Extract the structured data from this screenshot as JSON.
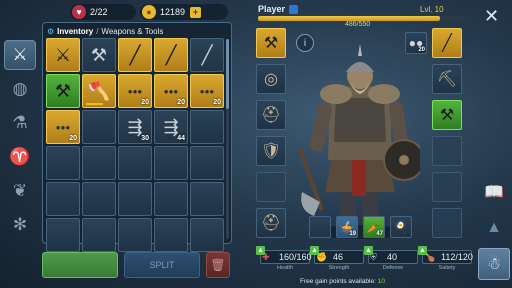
{
  "top_bar": {
    "energy": {
      "icon": "heart-icon",
      "value": "2/22"
    },
    "gold": {
      "icon": "coin-icon",
      "value": "12189",
      "add": "+"
    }
  },
  "side_tabs": [
    {
      "name": "weapons-tab",
      "icon": "crossed-axes-icon",
      "glyph": "⚔",
      "active": true
    },
    {
      "name": "globe-tab",
      "icon": "globe-icon",
      "glyph": "◍",
      "active": false
    },
    {
      "name": "potions-tab",
      "icon": "flask-icon",
      "glyph": "⚗",
      "active": false
    },
    {
      "name": "horn-tab",
      "icon": "horn-icon",
      "glyph": "♈",
      "active": false
    },
    {
      "name": "wings-tab",
      "icon": "wings-icon",
      "glyph": "❦",
      "active": false
    },
    {
      "name": "snowflake-tab",
      "icon": "snowflake-icon",
      "glyph": "✻",
      "active": false
    }
  ],
  "inventory": {
    "breadcrumb_root": "Inventory",
    "breadcrumb_sep": "/",
    "breadcrumb_current": "Weapons & Tools",
    "slots": [
      {
        "style": "gold",
        "glyph": "⚔",
        "count": ""
      },
      {
        "style": "dark",
        "glyph": "⚒",
        "count": ""
      },
      {
        "style": "gold",
        "glyph": "╱",
        "count": ""
      },
      {
        "style": "gold",
        "glyph": "╱",
        "count": ""
      },
      {
        "style": "dark",
        "glyph": "╱",
        "count": ""
      },
      {
        "style": "green",
        "glyph": "⚒",
        "count": ""
      },
      {
        "style": "gold",
        "glyph": "🪓",
        "count": "",
        "bar": 0.6
      },
      {
        "style": "gold",
        "glyph": "●●●",
        "count": "20"
      },
      {
        "style": "gold",
        "glyph": "●●●",
        "count": "20"
      },
      {
        "style": "gold",
        "glyph": "●●●",
        "count": "20"
      },
      {
        "style": "gold",
        "glyph": "●●●",
        "count": "20"
      },
      {
        "style": "empty",
        "glyph": "",
        "count": ""
      },
      {
        "style": "dark",
        "glyph": "⇶",
        "count": "30"
      },
      {
        "style": "dark",
        "glyph": "⇶",
        "count": "44"
      },
      {
        "style": "empty",
        "glyph": "",
        "count": ""
      },
      {
        "style": "empty",
        "glyph": "",
        "count": ""
      },
      {
        "style": "empty",
        "glyph": "",
        "count": ""
      },
      {
        "style": "empty",
        "glyph": "",
        "count": ""
      }
    ]
  },
  "buttons": {
    "equip": "",
    "split": "SPLIT",
    "delete": "🗑"
  },
  "player": {
    "name": "Player",
    "level": "Lvl. 10",
    "xp": "486/550",
    "xp_fraction": 0.8836
  },
  "equipment_left": [
    {
      "style": "gold",
      "glyph": "⚒",
      "name": "main-weapon-slot"
    },
    {
      "style": "dark",
      "glyph": "◎",
      "name": "shield-slot"
    },
    {
      "style": "dark",
      "glyph": "⛑",
      "name": "helmet-slot"
    },
    {
      "style": "dark",
      "glyph": "🛡",
      "name": "armor-slot"
    },
    {
      "style": "empty",
      "glyph": "",
      "name": "pants-slot"
    },
    {
      "style": "dark",
      "glyph": "⛑",
      "name": "boots-slot"
    }
  ],
  "equipment_right": [
    {
      "style": "gold",
      "glyph": "╱",
      "name": "spear-slot"
    },
    {
      "style": "dark",
      "glyph": "⛏",
      "name": "pickaxe-slot"
    },
    {
      "style": "green",
      "glyph": "⚒",
      "name": "axe-slot"
    },
    {
      "style": "empty",
      "glyph": "",
      "name": "empty-slot-1"
    },
    {
      "style": "empty",
      "glyph": "",
      "name": "empty-slot-2"
    },
    {
      "style": "empty",
      "glyph": "",
      "name": "empty-slot-3"
    }
  ],
  "ammo_slot": {
    "glyph": "●●",
    "count": "20"
  },
  "consumables": [
    {
      "style": "empty",
      "glyph": "",
      "count": ""
    },
    {
      "style": "blue",
      "glyph": "🍲",
      "count": "19"
    },
    {
      "style": "green",
      "glyph": "🥕",
      "count": "47"
    },
    {
      "style": "dark",
      "glyph": "🍳",
      "count": ""
    }
  ],
  "stats": [
    {
      "name": "Health",
      "value": "160",
      "max": "160",
      "icon": "cross-icon",
      "glyph": "✚"
    },
    {
      "name": "Strength",
      "value": "46",
      "max": "",
      "icon": "fist-icon",
      "glyph": "✊"
    },
    {
      "name": "Defense",
      "value": "40",
      "max": "",
      "icon": "helmet-icon",
      "glyph": "⛨"
    },
    {
      "name": "Satiety",
      "value": "112",
      "max": "120",
      "icon": "drumstick-icon",
      "glyph": "🍗"
    }
  ],
  "free_points": {
    "label": "Free gain points available:",
    "value": "10"
  },
  "right_nav": [
    {
      "name": "journal-button",
      "icon": "book-icon",
      "glyph": "📖",
      "active": false
    },
    {
      "name": "crafting-button",
      "icon": "pyramid-icon",
      "glyph": "▲",
      "active": false
    },
    {
      "name": "character-button",
      "icon": "robot-icon",
      "glyph": "☃",
      "active": true
    }
  ]
}
